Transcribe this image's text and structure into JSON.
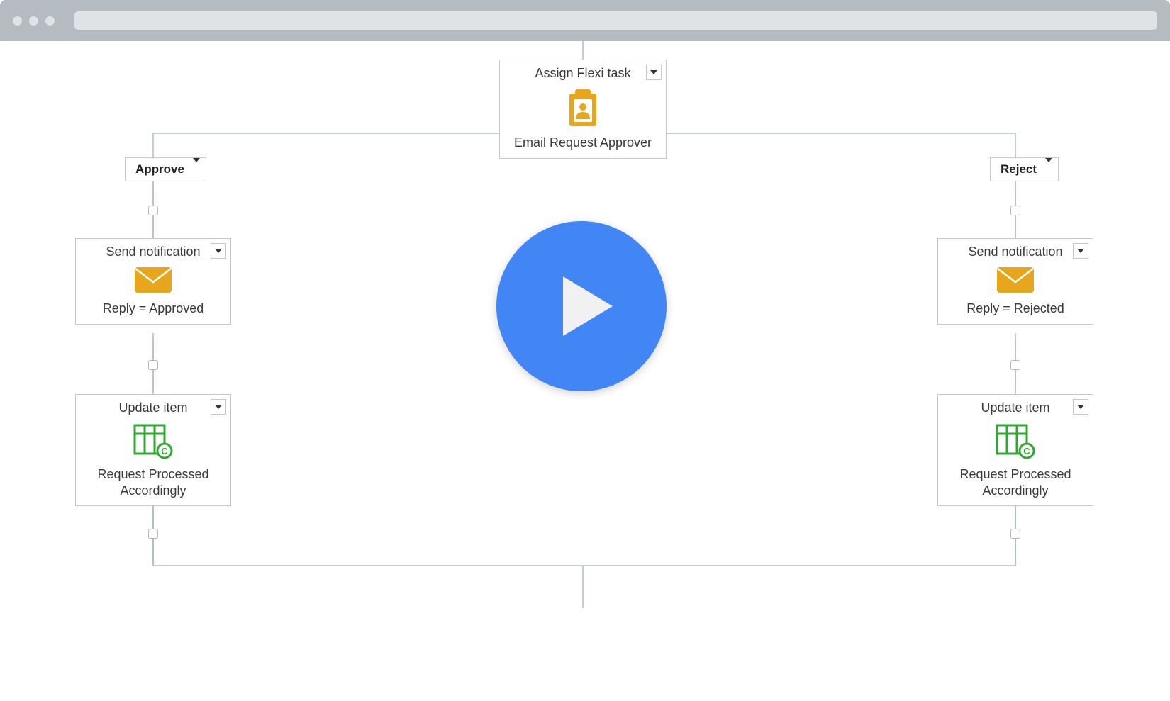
{
  "colors": {
    "accent_yellow": "#e8a61d",
    "accent_green": "#2fa82f",
    "play_blue": "#4285f4",
    "connector": "#9fb2c9"
  },
  "root_node": {
    "title": "Assign Flexi task",
    "subtitle": "Email Request Approver"
  },
  "branches": {
    "left": {
      "label": "Approve"
    },
    "right": {
      "label": "Reject"
    }
  },
  "left_path": {
    "notify": {
      "title": "Send notification",
      "subtitle": "Reply = Approved"
    },
    "update": {
      "title": "Update item",
      "subtitle": "Request Processed Accordingly"
    }
  },
  "right_path": {
    "notify": {
      "title": "Send notification",
      "subtitle": "Reply = Rejected"
    },
    "update": {
      "title": "Update item",
      "subtitle": "Request Processed Accordingly"
    }
  }
}
